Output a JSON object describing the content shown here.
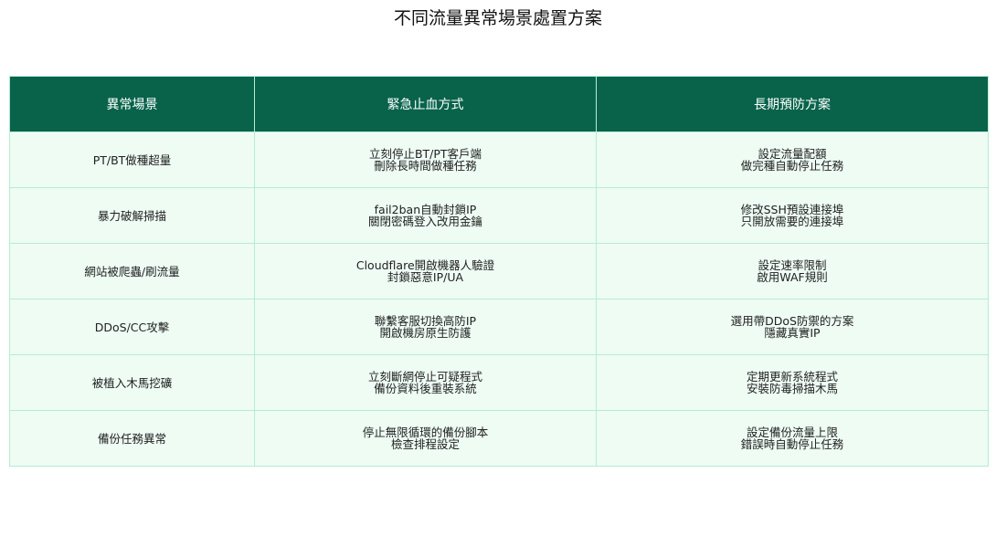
{
  "title": "不同流量異常場景處置方案",
  "table": {
    "headers": [
      "異常場景",
      "緊急止血方式",
      "長期預防方案"
    ],
    "rows": [
      {
        "scenario": "PT/BT做種超量",
        "emergency": [
          "立刻停止BT/PT客戶端",
          "刪除長時間做種任務"
        ],
        "prevention": [
          "設定流量配額",
          "做完種自動停止任務"
        ]
      },
      {
        "scenario": "暴力破解掃描",
        "emergency": [
          "fail2ban自動封鎖IP",
          "關閉密碼登入改用金鑰"
        ],
        "prevention": [
          "修改SSH預設連接埠",
          "只開放需要的連接埠"
        ]
      },
      {
        "scenario": "網站被爬蟲/刷流量",
        "emergency": [
          "Cloudflare開啟機器人驗證",
          "封鎖惡意IP/UA"
        ],
        "prevention": [
          "設定速率限制",
          "啟用WAF規則"
        ]
      },
      {
        "scenario": "DDoS/CC攻擊",
        "emergency": [
          "聯繫客服切換高防IP",
          "開啟機房原生防護"
        ],
        "prevention": [
          "選用帶DDoS防禦的方案",
          "隱藏真實IP"
        ]
      },
      {
        "scenario": "被植入木馬挖礦",
        "emergency": [
          "立刻斷網停止可疑程式",
          "備份資料後重裝系統"
        ],
        "prevention": [
          "定期更新系統程式",
          "安裝防毒掃描木馬"
        ]
      },
      {
        "scenario": "備份任務異常",
        "emergency": [
          "停止無限循環的備份腳本",
          "檢查排程設定"
        ],
        "prevention": [
          "設定備份流量上限",
          "錯誤時自動停止任務"
        ]
      }
    ]
  }
}
